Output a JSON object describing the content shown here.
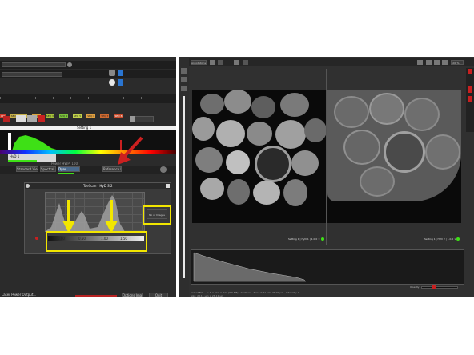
{
  "left_panel": {
    "top_dropdown_1": "",
    "top_dropdown_2": "",
    "sequence_tags": [
      "ON",
      "SEQUENTIAL",
      "SEQ 2",
      "SEQ 3",
      "SEQ 4",
      "SEQ 5",
      "SEQ 6",
      "SEQ 7",
      "SEQ 8",
      "SEQ 9",
      "SEQ 10",
      "SEQ 11",
      "SEQ 12",
      "SEQ 13",
      "END"
    ],
    "setting_label": "Setting 1",
    "tabs": [
      "Standard View",
      "Spectral",
      "Dyes",
      "Reference Dyes"
    ],
    "channel_fields": [
      "HyD 1",
      "HyD 2"
    ],
    "status_text": "Power HWP: 100",
    "emission_label": "Emission"
  },
  "lut_dialog": {
    "title": "TaeScan - HyD S 2",
    "tick_labels": [
      "0.00",
      "0.50",
      "1.00",
      "1.50"
    ],
    "reset_button": "No of Images"
  },
  "right_panel": {
    "toolbar_label": "Annotations",
    "zoom_value": "100 %",
    "image_left_caption": "Setting 1 | HyD 1 | 1.0.0 ×",
    "image_right_caption": "Setting 1 | HyD 2 | 1.0.0 ×",
    "status_line_1": "Scaled FLI ... x: 1 × 512 × 512 (3.0 MB) - Confocal - Pixel: 0.21 µm, 21.90 µm - Intensity: 0",
    "status_line_2": "Size: 28.11 µm × 28.11 µm",
    "slider_label": "Opacity"
  },
  "bottom_left": {
    "footer_text": "Laser Power Output...",
    "button_1": "Options Image",
    "button_2": "Quit"
  },
  "colors": {
    "annotation": "#f2e600",
    "arrow": "#cc2020",
    "histogram": "#3ee016"
  }
}
